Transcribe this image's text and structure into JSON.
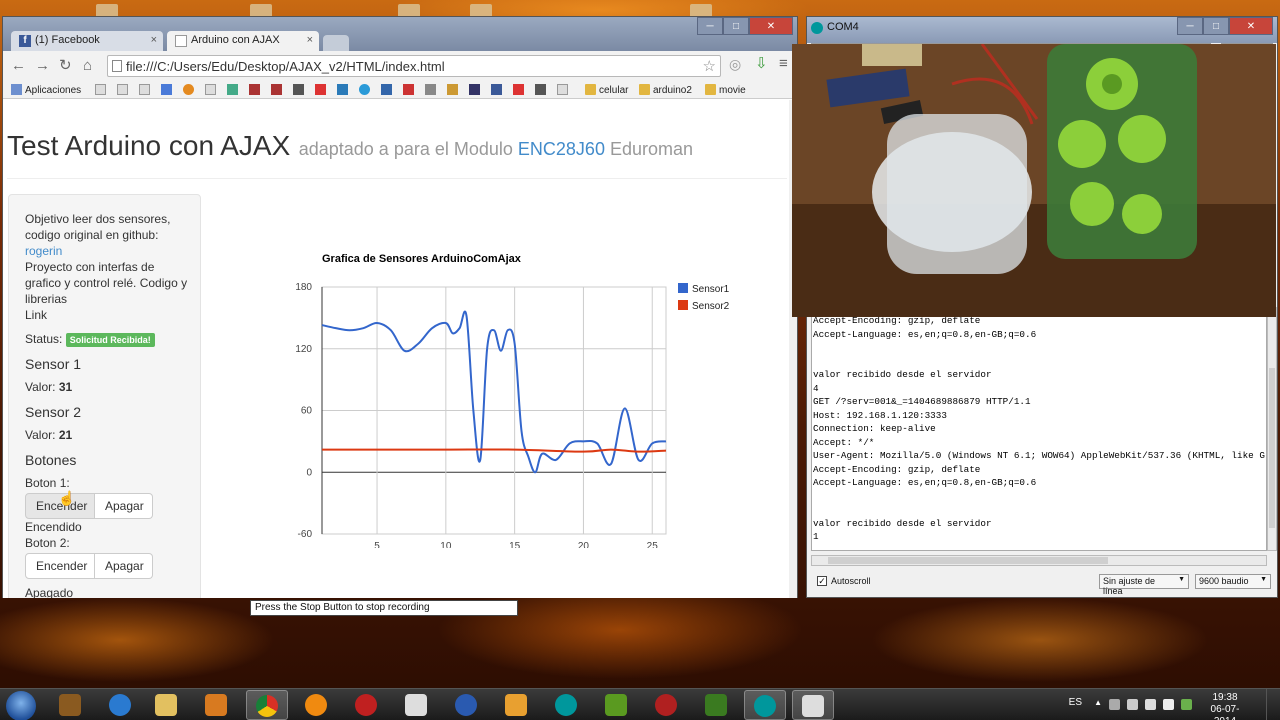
{
  "browser": {
    "tabs": [
      {
        "label": "(1) Facebook"
      },
      {
        "label": "Arduino con AJAX"
      }
    ],
    "url": "file:///C:/Users/Edu/Desktop/AJAX_v2/HTML/index.html",
    "bookmarks": {
      "apps": "Aplicaciones",
      "folders": [
        "celular",
        "arduino2",
        "movie"
      ]
    }
  },
  "page": {
    "title": "Test Arduino con AJAX",
    "subtitle_pre": "adaptado a para el Modulo ",
    "subtitle_link": "ENC28J60",
    "subtitle_post": " Eduroman",
    "description_1": "Objetivo leer dos sensores, codigo original en github:",
    "link_rogerin": "rogerin",
    "description_2": "Proyecto con interfas de grafico y control relé. Codigo y librerias",
    "link_label": "Link",
    "status_label": "Status:",
    "status_badge": "Solicitud Recibida!",
    "sensor1_heading": "Sensor 1",
    "sensor1_value_label": "Valor:",
    "sensor1_value": "31",
    "sensor2_heading": "Sensor 2",
    "sensor2_value_label": "Valor:",
    "sensor2_value": "21",
    "buttons_heading": "Botones",
    "boton1_label": "Boton 1:",
    "boton1_on": "Encender",
    "boton1_off": "Apagar",
    "boton1_state": "Encendido",
    "boton2_label": "Boton 2:",
    "boton2_on": "Encender",
    "boton2_off": "Apagar",
    "boton2_state": "Apagado"
  },
  "chart_data": {
    "type": "line",
    "title": "Grafica de Sensores ArduinoComAjax",
    "xlabel": "",
    "ylabel": "",
    "xlim": [
      1,
      26
    ],
    "ylim": [
      -60,
      180
    ],
    "xticks": [
      5,
      10,
      15,
      20,
      25
    ],
    "yticks": [
      180,
      120,
      60,
      0,
      -60
    ],
    "grid": true,
    "legend": "right",
    "series": [
      {
        "name": "Sensor1",
        "color": "#3366cc",
        "x": [
          1,
          2,
          3,
          4,
          5,
          6,
          7,
          8,
          9,
          10,
          10.5,
          11,
          11.5,
          12,
          12.5,
          13,
          13.5,
          14,
          14.5,
          15,
          15.5,
          16,
          16.5,
          17,
          18,
          19,
          20,
          21,
          22,
          23,
          24,
          25,
          26
        ],
        "y": [
          143,
          140,
          138,
          140,
          145,
          138,
          118,
          125,
          140,
          145,
          135,
          140,
          152,
          60,
          12,
          120,
          138,
          118,
          138,
          125,
          40,
          15,
          0,
          18,
          12,
          28,
          30,
          28,
          8,
          62,
          12,
          28,
          30
        ]
      },
      {
        "name": "Sensor2",
        "color": "#dc3912",
        "x": [
          1,
          5,
          10,
          15,
          20,
          22,
          24,
          26
        ],
        "y": [
          22,
          22,
          22,
          22,
          20,
          22,
          20,
          21
        ]
      }
    ]
  },
  "serial_monitor": {
    "title": "COM4",
    "lines": [
      "Accept-Encoding: gzip, deflate",
      "Accept-Language: es,en;q=0.8,en-GB;q=0.6",
      "",
      "",
      "valor recibido desde el servidor",
      "4",
      "GET /?serv=001&_=1404689886879 HTTP/1.1",
      "Host: 192.168.1.120:3333",
      "Connection: keep-alive",
      "Accept: */*",
      "User-Agent: Mozilla/5.0 (Windows NT 6.1; WOW64) AppleWebKit/537.36 (KHTML, like G",
      "Accept-Encoding: gzip, deflate",
      "Accept-Language: es,en;q=0.8,en-GB;q=0.6",
      "",
      "",
      "valor recibido desde el servidor",
      "1"
    ],
    "autoscroll": "Autoscroll",
    "line_ending": "Sin ajuste de línea",
    "baud": "9600 baudio"
  },
  "recorder_tip": "Press the Stop Button to stop recording",
  "taskbar": {
    "lang": "ES",
    "time": "19:38",
    "date": "06-07-2014"
  }
}
